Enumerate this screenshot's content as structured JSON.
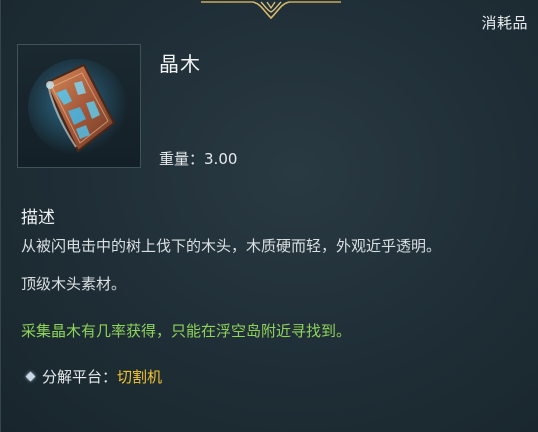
{
  "tooltip": {
    "category": "消耗品",
    "item_name": "晶木",
    "item_icon": "crystal-wood-icon",
    "weight_label": "重量：",
    "weight_value": "3.00",
    "description_title": "描述",
    "description_lines": [
      "从被闪电击中的树上伐下的木头，木质硬而轻，外观近乎透明。",
      "顶级木头素材。"
    ],
    "acquisition_note": "采集晶木有几率获得，只能在浮空岛附近寻找到。",
    "dismantle_label": "分解平台：",
    "dismantle_value": "切割机"
  },
  "colors": {
    "background": "#1f2e36",
    "acquisition_text": "#8ed35a",
    "dismantle_value": "#f1c232",
    "ornament": "#c9a85a"
  }
}
